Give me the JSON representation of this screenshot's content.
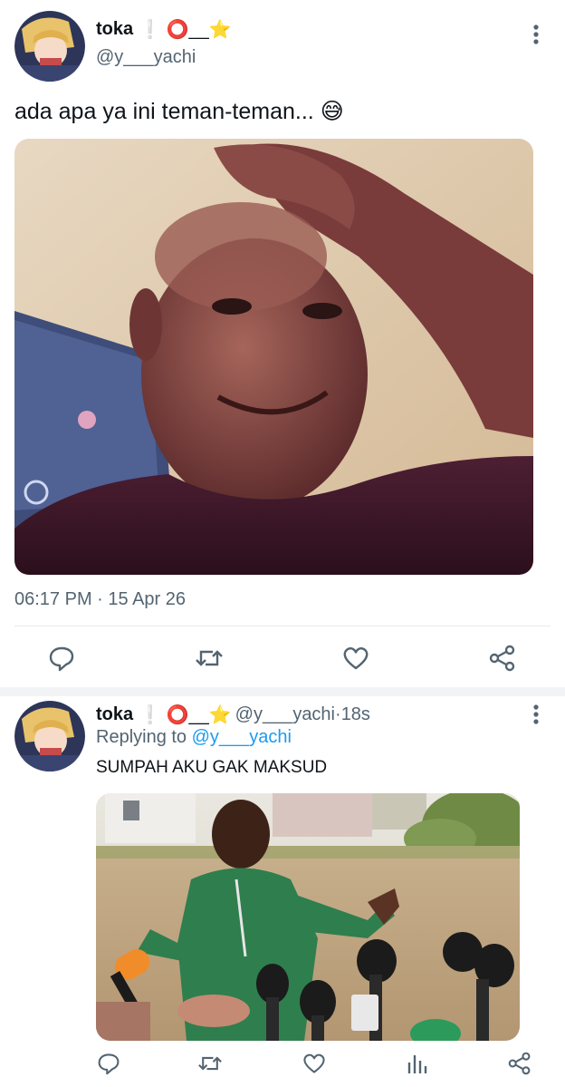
{
  "main_tweet": {
    "display_name": "toka",
    "name_emoji": "❕ ⭕__⭐",
    "handle": "@y___yachi",
    "text": "ada apa ya ini teman-teman... 😅",
    "timestamp": "06:17 PM · 15 Apr 26",
    "icons": [
      "reply-icon",
      "retweet-icon",
      "like-icon",
      "share-icon"
    ]
  },
  "reply_tweet": {
    "display_name": "toka",
    "name_emoji": "❕ ⭕__⭐",
    "handle": "@y___yachi",
    "time_sep": " · ",
    "age": "18s",
    "replying_prefix": "Replying to ",
    "replying_to": "@y___yachi",
    "text": "SUMPAH AKU GAK MAKSUD",
    "icons": [
      "reply-icon",
      "retweet-icon",
      "like-icon",
      "views-icon",
      "share-icon"
    ]
  },
  "colors": {
    "accent": "#1d9bf0",
    "muted_text": "#536471",
    "divider": "#e6e9ec"
  }
}
